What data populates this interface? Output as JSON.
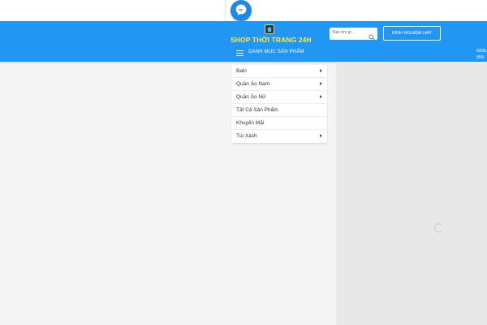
{
  "brand": {
    "name": "SHOP THỜI TRANG 24H",
    "logo_icon": "shop-logo-icon"
  },
  "colors": {
    "header": "#2196f3",
    "shop_name": "#ffeb3b",
    "background": "#f4f4f4"
  },
  "search": {
    "placeholder": "Bạn tìm gì..."
  },
  "header": {
    "cta_label": "KINH NGHIỆM HAY",
    "phone_1": "0336",
    "phone_2": "056-"
  },
  "category_bar": {
    "label": "DANH MỤC SẢN PHẨM"
  },
  "menu": {
    "items": [
      {
        "label": "Balo"
      },
      {
        "label": "Quần Áo Nam"
      },
      {
        "label": "Quần Áo Nữ"
      },
      {
        "label": "Tất Cả Sản Phẩm"
      },
      {
        "label": "Khuyến Mãi"
      },
      {
        "label": "Túi Xách"
      }
    ]
  }
}
